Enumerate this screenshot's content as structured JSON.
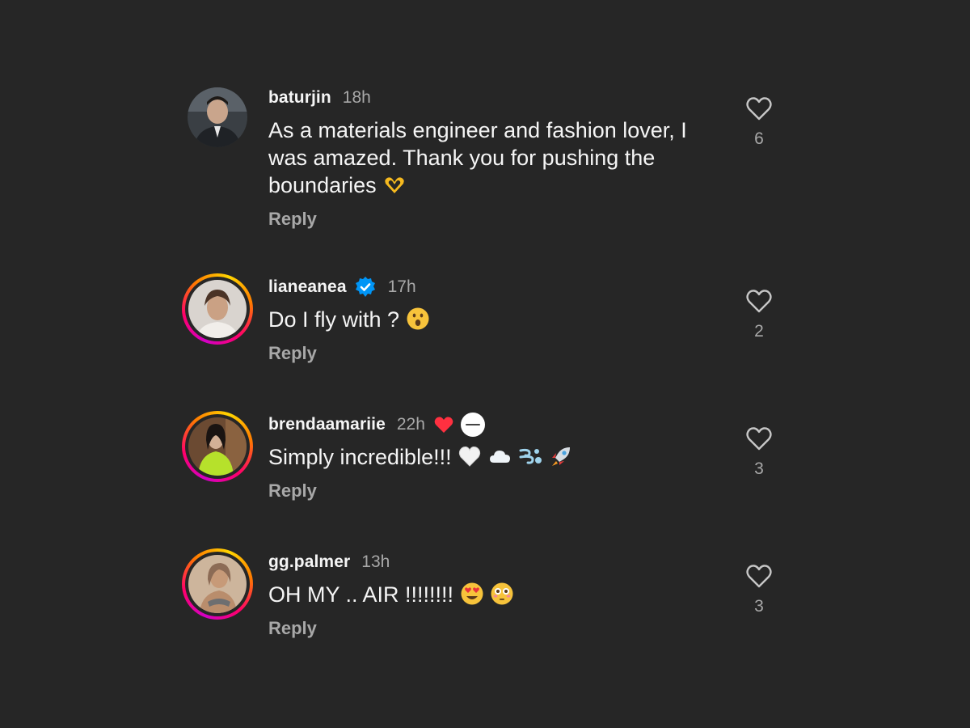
{
  "comments": [
    {
      "username": "baturjin",
      "time": "18h",
      "text": "As a materials engineer and fashion lover, I was amazed. Thank you for pushing the boundaries",
      "reply_label": "Reply",
      "like_count": "6"
    },
    {
      "username": "lianeanea",
      "time": "17h",
      "text": "Do I fly with ?",
      "reply_label": "Reply",
      "like_count": "2"
    },
    {
      "username": "brendaamariie",
      "time": "22h",
      "text": "Simply incredible!!!",
      "reply_label": "Reply",
      "like_count": "3"
    },
    {
      "username": "gg.palmer",
      "time": "13h",
      "text": "OH MY .. AIR !!!!!!!!",
      "reply_label": "Reply",
      "like_count": "3"
    }
  ],
  "colors": {
    "background": "#262626",
    "secondary_text": "#a8a8a8",
    "verified_blue": "#0095f6",
    "liked_red": "#ff3040"
  },
  "icons": {
    "like": "heart-outline-icon",
    "creator_liked": "heart-filled-icon",
    "verified": "verified-badge-icon",
    "author": "author-avatar-badge-icon"
  }
}
